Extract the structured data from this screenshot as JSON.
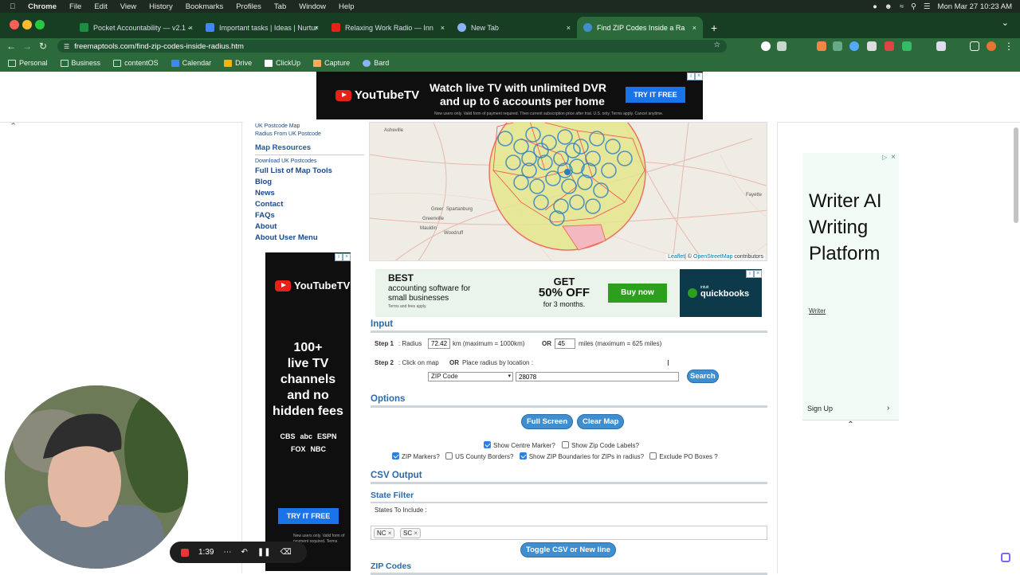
{
  "macbar": {
    "app": "Chrome",
    "menus": [
      "File",
      "Edit",
      "View",
      "History",
      "Bookmarks",
      "Profiles",
      "Tab",
      "Window",
      "Help"
    ],
    "datetime": "Mon Mar 27  10:23 AM"
  },
  "tabs": [
    {
      "label": "Pocket Accountability — v2.1 -",
      "color": "#1e8e3e"
    },
    {
      "label": "Important tasks | Ideas | Nurtur",
      "color": "#4285f4"
    },
    {
      "label": "Relaxing Work Radio — Inn",
      "color": "#e62117"
    },
    {
      "label": "New Tab",
      "color": "#8ab4f8"
    },
    {
      "label": "Find ZIP Codes Inside a Ra",
      "color": "#3f8fd0"
    }
  ],
  "address": {
    "url": "freemaptools.com/find-zip-codes-inside-radius.htm"
  },
  "bookmarks": [
    "Personal",
    "Business",
    "contentOS",
    "Calendar",
    "Drive",
    "ClickUp",
    "Capture",
    "Bard"
  ],
  "top_ad": {
    "logo": "YouTubeTV",
    "headline": "Watch live TV with unlimited DVR",
    "headline2": "and up to 6 accounts per home",
    "cta": "TRY IT FREE",
    "fine": "New users only. Valid form of payment required. Then current subscription price after trial. U.S. only. Terms apply. Cancel anytime."
  },
  "leftnav": {
    "small_top": [
      "UK Postcode Map",
      "Radius From UK Postcode"
    ],
    "heading": "Map Resources",
    "small": "Download UK Postcodes",
    "links": [
      "Full List of Map Tools",
      "Blog",
      "News",
      "Contact",
      "FAQs",
      "About",
      "About User Menu"
    ]
  },
  "side_ad": {
    "logo": "YouTubeTV",
    "text": [
      "100+",
      "live TV",
      "channels",
      "and no",
      "hidden fees"
    ],
    "networks": [
      "CBS",
      "abc",
      "ESPN",
      "FOX",
      "NBC"
    ],
    "cta": "TRY IT FREE",
    "fine": "New users only. Valid form of payment required. Terms apply."
  },
  "map": {
    "labels": [
      "Asheville",
      "Greer",
      "Spartanburg",
      "Greenville",
      "Mauldin",
      "Woodruff",
      "Fayette"
    ],
    "attribution_link": "Leaflet",
    "attribution_text": "| © ",
    "osm": "OpenStreetMap",
    "contributors": " contributors"
  },
  "qb_ad": {
    "best": "BEST",
    "line1": "accounting software for",
    "line2": "small businesses",
    "fine": "Terms and fees apply.",
    "get": "GET",
    "off": "50% OFF",
    "months": "for 3 months.",
    "cta": "Buy now",
    "brand": "quickbooks",
    "brand_small": "intuit"
  },
  "input": {
    "section": "Input",
    "step1_label": "Step 1",
    "step1_radius": ": Radius",
    "km_value": "72.42",
    "km_text": "km (maximum = 1000km)",
    "or": "OR",
    "miles_value": "45",
    "miles_text": "miles (maximum = 625 miles)",
    "step2_label": "Step 2",
    "step2_text": ": Click on map",
    "step2_or": "OR",
    "step2_text2": "Place radius by location :",
    "select_value": "ZIP Code",
    "location_value": "28078",
    "search_button": "Search"
  },
  "options": {
    "section": "Options",
    "full_screen": "Full Screen",
    "clear_map": "Clear Map",
    "checks_row1": [
      {
        "label": "Show Centre Marker?",
        "checked": true
      },
      {
        "label": "Show Zip Code Labels?",
        "checked": false
      }
    ],
    "checks_row2": [
      {
        "label": "ZIP Markers?",
        "checked": true
      },
      {
        "label": "US County Borders?",
        "checked": false
      },
      {
        "label": "Show ZIP Boundaries for ZIPs in radius?",
        "checked": true
      },
      {
        "label": "Exclude PO Boxes ?",
        "checked": false
      }
    ]
  },
  "csv": {
    "section": "CSV Output",
    "state_filter": "State Filter",
    "states_label": "States To Include :",
    "states": [
      "NC",
      "SC"
    ],
    "toggle_button": "Toggle CSV or New line",
    "zip_codes": "ZIP Codes"
  },
  "right_ad": {
    "headline": "Writer AI Writing Platform",
    "brand": "Writer",
    "signup": "Sign Up"
  },
  "recorder": {
    "time": "1:39"
  },
  "colors": {
    "accent": "#3f8fd0",
    "chrome_green": "#2c6a3c"
  }
}
